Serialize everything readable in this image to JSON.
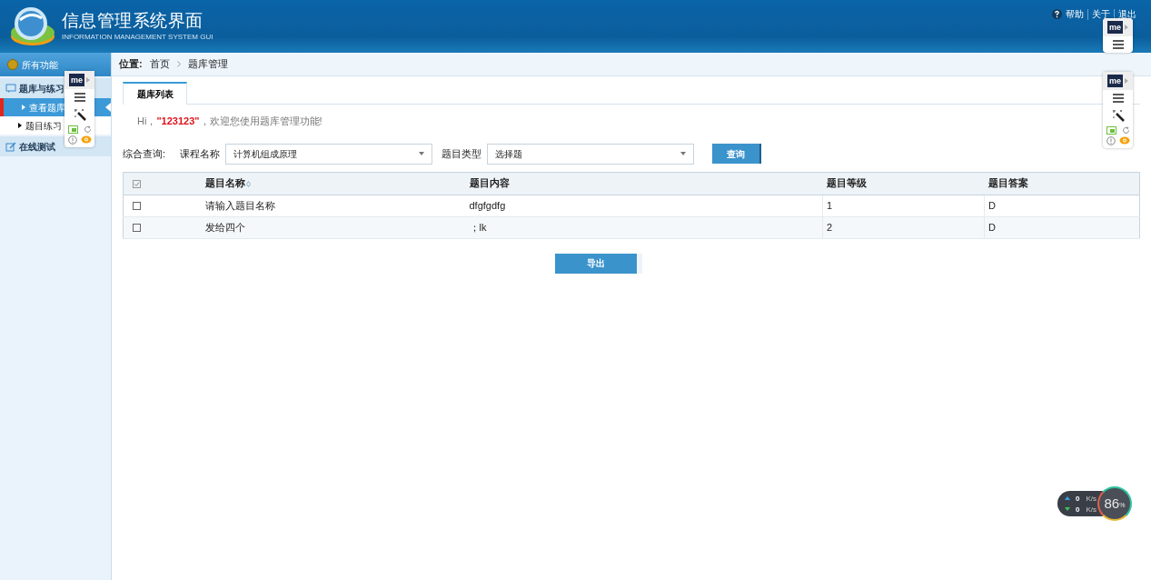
{
  "header": {
    "title": "信息管理系统界面",
    "subtitle": "INFORMATION MANAGEMENT SYSTEM GUI",
    "links": [
      {
        "label": "帮助",
        "kind": "help"
      },
      {
        "label": "关于",
        "kind": "plain"
      },
      {
        "label": "退出",
        "kind": "plain"
      }
    ]
  },
  "sidebar": {
    "title": "所有功能",
    "groups": [
      {
        "label": "题库与练习",
        "kind": "list",
        "children": [
          {
            "label": "查看题库",
            "selected": true
          },
          {
            "label": "题目练习",
            "selected": false
          }
        ]
      },
      {
        "label": "在线测试",
        "kind": "edit"
      }
    ]
  },
  "breadcrumb": {
    "label": "位置:",
    "items": [
      "首页",
      "题库管理"
    ]
  },
  "tabs": [
    {
      "label": "题库列表",
      "selected": true
    }
  ],
  "greeting": "Hi，**\"123123\"**，欢迎您使用题库管理功能!",
  "query": {
    "label": "综合查询:",
    "fields": [
      {
        "label": "课程名称",
        "value": "计算机组成原理"
      },
      {
        "label": "题目类型",
        "value": "选择题"
      }
    ],
    "button": "查询"
  },
  "table": {
    "select_all_checked": true,
    "columns": [
      "题目名称",
      "题目内容",
      "题目等级",
      "题目答案"
    ],
    "rows": [
      {
        "checked": false,
        "cells": [
          "请输入题目名称",
          "dfgfgdfg",
          "1",
          "D"
        ]
      },
      {
        "checked": false,
        "cells": [
          "发给四个",
          "；lk",
          "2",
          "D"
        ]
      }
    ]
  },
  "export_button": "导出",
  "toolbars": [
    {
      "kind": "short",
      "logo": "me"
    },
    {
      "kind": "full",
      "logo": "me"
    },
    {
      "kind": "full",
      "logo": "me"
    }
  ],
  "speed_widget": {
    "up": "0",
    "up_unit": "K/s",
    "down": "0",
    "down_unit": "K/s",
    "percent": "86",
    "percent_sign": "%"
  }
}
